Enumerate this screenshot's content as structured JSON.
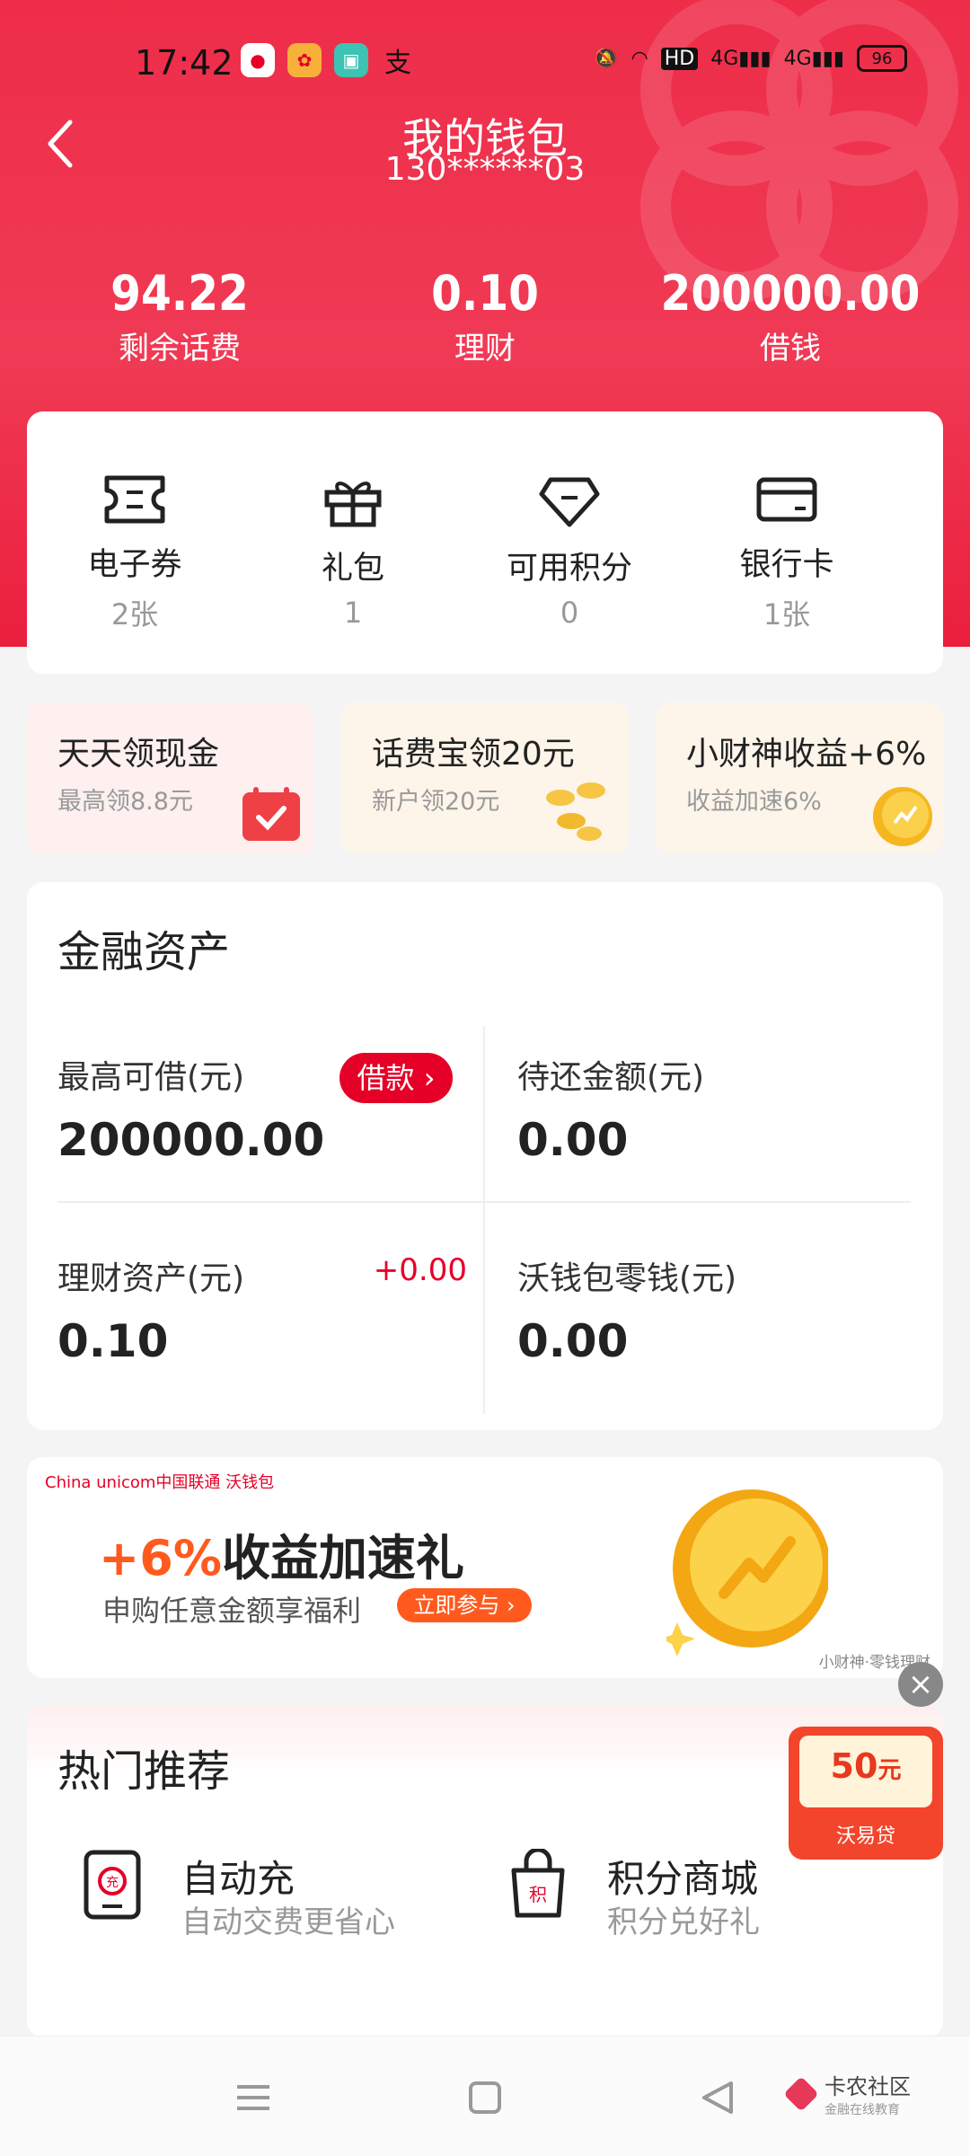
{
  "status_bar": {
    "time": "17:42",
    "app_icons": [
      "du-icon",
      "app2-icon",
      "app3-icon",
      "alipay-icon"
    ],
    "battery": "96"
  },
  "header": {
    "title": "我的钱包",
    "phone": "130******03"
  },
  "stats": [
    {
      "value": "94.22",
      "label": "剩余话费"
    },
    {
      "value": "0.10",
      "label": "理财"
    },
    {
      "value": "200000.00",
      "label": "借钱"
    }
  ],
  "quick": [
    {
      "label": "电子券",
      "count": "2张",
      "icon": "ticket-icon"
    },
    {
      "label": "礼包",
      "count": "1",
      "icon": "gift-icon"
    },
    {
      "label": "可用积分",
      "count": "0",
      "icon": "diamond-icon"
    },
    {
      "label": "银行卡",
      "count": "1张",
      "icon": "bank-card-icon"
    }
  ],
  "promos": [
    {
      "title": "天天领现金",
      "sub": "最高领8.8元",
      "bg": "#fdf0ef"
    },
    {
      "title": "话费宝领20元",
      "sub": "新户领20元",
      "bg": "#fdf5ea"
    },
    {
      "title": "小财神收益+6%",
      "sub": "收益加速6%",
      "bg": "#fdf5ea"
    }
  ],
  "finance": {
    "title": "金融资产",
    "max_loan_label": "最高可借(元)",
    "max_loan_value": "200000.00",
    "loan_button": "借款",
    "repay_label": "待还金额(元)",
    "repay_value": "0.00",
    "wealth_label": "理财资产(元)",
    "wealth_value": "0.10",
    "wealth_change": "+0.00",
    "change_label": "沃钱包零钱(元)",
    "change_value": "0.00"
  },
  "banner": {
    "logo_text": "China unicom中国联通  沃钱包",
    "pct": "+6%",
    "head": "收益加速礼",
    "sub": "申购任意金额享福利",
    "button": "立即参与",
    "note": "小财神·零钱理财"
  },
  "hot": {
    "title": "热门推荐",
    "items": [
      {
        "title": "自动充",
        "sub": "自动交费更省心",
        "icon": "auto-recharge-icon"
      },
      {
        "title": "积分商城",
        "sub": "积分兑好礼",
        "icon": "points-mall-icon"
      }
    ]
  },
  "redpacket": {
    "amount": "50",
    "unit": "元",
    "label": "沃易贷"
  },
  "navbar": {
    "brand": "卡农社区",
    "brand_sub": "金融在线教育"
  },
  "colors": {
    "brand_red": "#ee2d49",
    "accent_red": "#e60027",
    "orange": "#ff5a1e"
  }
}
